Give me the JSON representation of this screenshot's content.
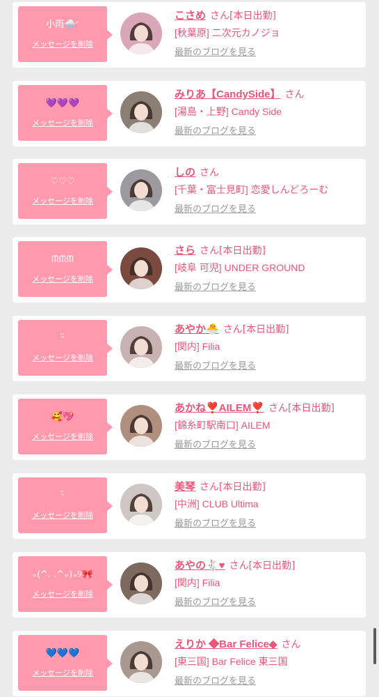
{
  "cards": [
    {
      "message": "小雨🌧️ᐟ",
      "name": "こさめ",
      "san": "さん",
      "status": "[本日出勤]",
      "shop": "[秋葉原] 二次元カノジョ",
      "delete_label": "メッセージを削除",
      "blog_label": "最新のブログを見る"
    },
    {
      "message": "💜💜💜",
      "name": "みりあ【CandySide】",
      "san": "さん",
      "status": "",
      "shop": "[湯島・上野] Candy Side",
      "delete_label": "メッセージを削除",
      "blog_label": "最新のブログを見る"
    },
    {
      "message": "♡♡♡",
      "name": "しの",
      "san": "さん",
      "status": "",
      "shop": "[千葉・富士見町] 恋愛しんどろーむ",
      "delete_label": "メッセージを削除",
      "blog_label": "最新のブログを見る"
    },
    {
      "message": "ᙏᙏᙏ",
      "name": "さら",
      "san": "さん",
      "status": "[本日出勤]",
      "shop": "[岐阜 可児] UNDER GROUND",
      "delete_label": "メッセージを削除",
      "blog_label": "最新のブログを見る"
    },
    {
      "message": "ᵕ̈",
      "name": "あやか🐣",
      "san": "さん",
      "status": "[本日出勤]",
      "shop": "[関内] Filia",
      "delete_label": "メッセージを削除",
      "blog_label": "最新のブログを見る"
    },
    {
      "message": "🥰💖",
      "name": "あかね❣️AILEM❣️",
      "san": "さん",
      "status": "[本日出勤]",
      "shop": "[錦糸町駅南口] AILEM",
      "delete_label": "メッセージを削除",
      "blog_label": "最新のブログを見る"
    },
    {
      "message": "ᵕ̈",
      "name": "美琴",
      "san": "さん",
      "status": "[本日出勤]",
      "shop": "[中洲] CLUB Ultima",
      "delete_label": "メッセージを削除",
      "blog_label": "最新のブログを見る"
    },
    {
      "message": "₌(^. .^₌)₌୨🎀",
      "name": "あやの🐇♥",
      "san": "さん",
      "status": "[本日出勤]",
      "shop": "[関内] Filia",
      "delete_label": "メッセージを削除",
      "blog_label": "最新のブログを見る"
    },
    {
      "message": "💙💙💙",
      "name": "えりか ◆Bar Felice◆",
      "san": "さん",
      "status": "",
      "shop": "[東三国] Bar Felice 東三国",
      "delete_label": "メッセージを削除",
      "blog_label": "最新のブログを見る"
    }
  ],
  "avatar_colors": [
    "#d9a7b8",
    "#8b7f75",
    "#9c9a9f",
    "#7a4a3e",
    "#c9b3b0",
    "#b08f7f",
    "#cfc7c4",
    "#7d6a5e",
    "#a89890"
  ]
}
